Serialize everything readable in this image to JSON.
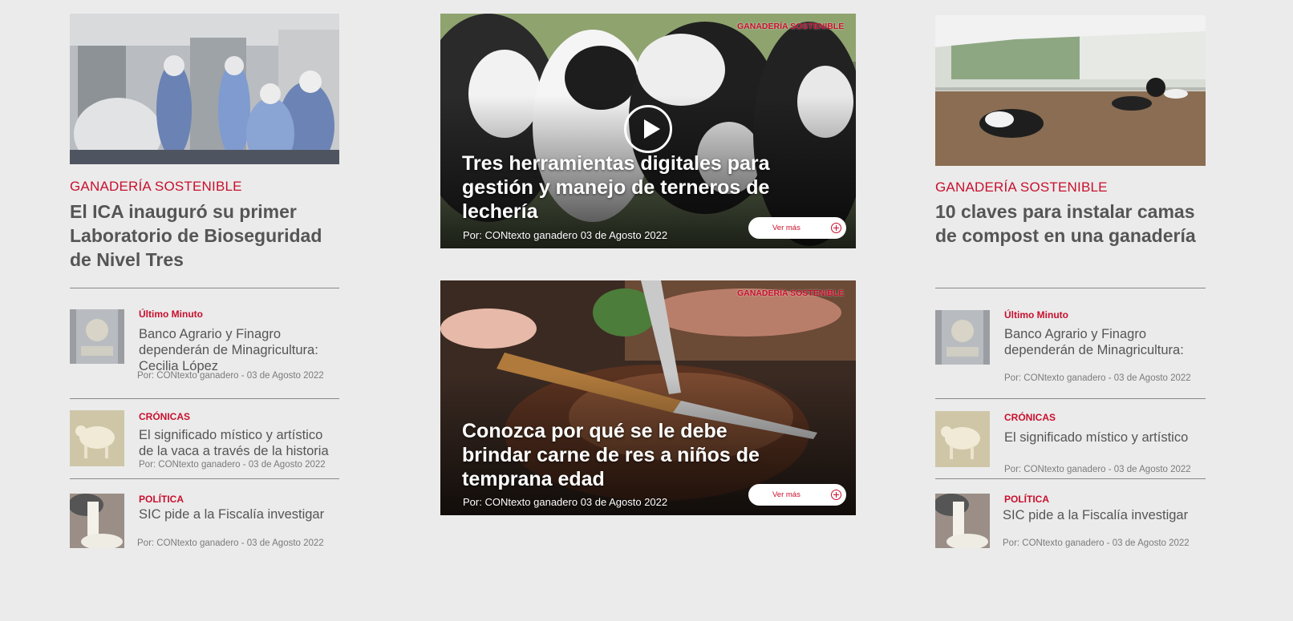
{
  "left": {
    "main": {
      "category": "GANADERÍA SOSTENIBLE",
      "title": "El ICA inauguró su primer Laboratorio de Bioseguridad de Nivel Tres"
    },
    "items": [
      {
        "category": "Último Minuto",
        "title": "Banco Agrario y Finagro dependerán de Minagricultura: Cecilia López",
        "byline": "Por: CONtexto ganadero - 03 de Agosto 2022"
      },
      {
        "category": "CRÓNICAS",
        "title": "El significado místico y artístico de la vaca a través de la historia",
        "byline": "Por: CONtexto ganadero - 03 de Agosto 2022"
      },
      {
        "category": "POLÍTICA",
        "title": "SIC pide a la Fiscalía investigar",
        "byline": "Por: CONtexto ganadero - 03 de Agosto 2022"
      }
    ]
  },
  "center": {
    "features": [
      {
        "category": "GANADERÍA SOSTENIBLE",
        "title": "Tres herramientas digitales para gestión y manejo de terneros de lechería",
        "byline": "Por:  CONtexto ganadero 03 de Agosto 2022",
        "button": "Ver más",
        "icon": "play-icon"
      },
      {
        "category": "GANADERÍA SOSTENIBLE",
        "title": "Conozca por qué se le debe brindar carne de res a niños de temprana edad",
        "byline": "Por:  CONtexto ganadero 03 de Agosto 2022",
        "button": "Ver más"
      }
    ]
  },
  "right": {
    "main": {
      "category": "GANADERÍA SOSTENIBLE",
      "title": "10 claves para instalar camas de compost en una ganadería"
    },
    "items": [
      {
        "category": "Último Minuto",
        "title": "Banco Agrario y Finagro dependerán de Minagricultura:",
        "byline": "Por: CONtexto ganadero - 03 de Agosto 2022"
      },
      {
        "category": "CRÓNICAS",
        "title": "El significado místico y artístico",
        "byline": "Por: CONtexto ganadero - 03 de Agosto 2022"
      },
      {
        "category": "POLÍTICA",
        "title": "SIC pide a la Fiscalía investigar",
        "byline": "Por: CONtexto ganadero - 03 de Agosto 2022"
      }
    ]
  },
  "colors": {
    "accent": "#c8102e",
    "background": "#ebebeb",
    "text": "#555555"
  }
}
